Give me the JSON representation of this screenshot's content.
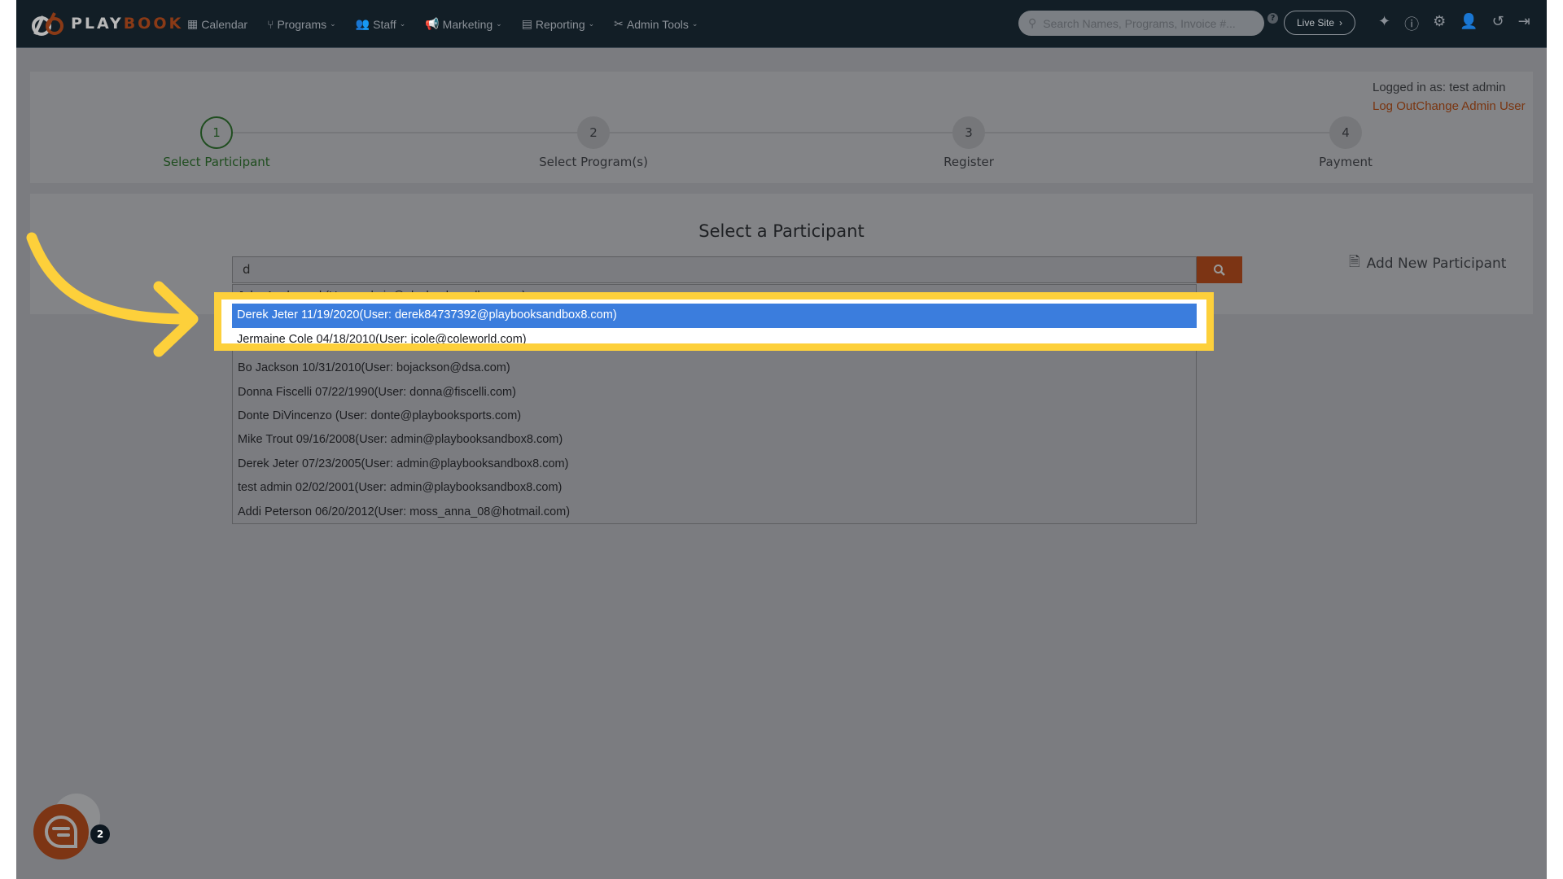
{
  "nav": {
    "logo_play": "PLAY",
    "logo_book": "BOOK",
    "menu": [
      {
        "label": "Calendar",
        "icon": "calendar-icon"
      },
      {
        "label": "Programs",
        "icon": "branch-icon"
      },
      {
        "label": "Staff",
        "icon": "users-icon"
      },
      {
        "label": "Marketing",
        "icon": "megaphone-icon"
      },
      {
        "label": "Reporting",
        "icon": "document-icon"
      },
      {
        "label": "Admin Tools",
        "icon": "tools-icon"
      }
    ],
    "search_placeholder": "Search Names, Programs, Invoice #...",
    "live_site": "Live Site"
  },
  "login": {
    "logged_in": "Logged in as: test admin",
    "log_out": "Log Out",
    "change_admin": "Change Admin User"
  },
  "steps": [
    {
      "num": "1",
      "label": "Select Participant",
      "active": true
    },
    {
      "num": "2",
      "label": "Select Program(s)"
    },
    {
      "num": "3",
      "label": "Register"
    },
    {
      "num": "4",
      "label": "Payment"
    }
  ],
  "main": {
    "title": "Select a Participant",
    "search_value": "d",
    "add_new": "Add New Participant"
  },
  "results": [
    "John Appleseed (User: admin@playbooksandbox.com)",
    "Derek Jeter 11/19/2020(User: derek84737392@playbooksandbox8.com)",
    "Jermaine Cole 04/18/2010(User: jcole@coleworld.com)",
    "Bo Jackson 10/31/2010(User: bojackson@dsa.com)",
    "Donna Fiscelli 07/22/1990(User: donna@fiscelli.com)",
    "Donte DiVincenzo (User: donte@playbooksports.com)",
    "Mike Trout 09/16/2008(User: admin@playbooksandbox8.com)",
    "Derek Jeter 07/23/2005(User: admin@playbooksandbox8.com)",
    "test admin 02/02/2001(User: admin@playbooksandbox8.com)",
    "Addi Peterson 06/20/2012(User: moss_anna_08@hotmail.com)"
  ],
  "selected_index": 1,
  "chat": {
    "badge": "2"
  },
  "colors": {
    "highlight": "#fdd03b",
    "selected": "#3b7ddd",
    "brand": "#b0501e",
    "nav": "#121e26"
  }
}
